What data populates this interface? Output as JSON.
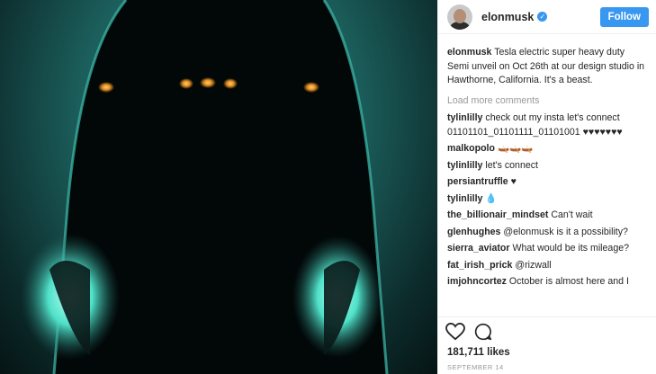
{
  "post": {
    "username": "elonmusk",
    "follow_label": "Follow",
    "verified_glyph": "✓",
    "caption": {
      "user": "elonmusk",
      "text": "Tesla electric super heavy duty Semi unveil on Oct 26th at our design studio in Hawthorne, California. It's a beast."
    },
    "load_more_label": "Load more comments",
    "comments": [
      {
        "user": "tylinlilly",
        "text": "check out my insta let's connect 01101101_01101111_01101001 ♥♥♥♥♥♥♥"
      },
      {
        "user": "malkopolo",
        "text": "🛶🛶🛶"
      },
      {
        "user": "tylinlilly",
        "text": "let's connect"
      },
      {
        "user": "persiantruffle",
        "text": "♥"
      },
      {
        "user": "tylinlilly",
        "text": "💧"
      },
      {
        "user": "the_billionair_mindset",
        "text": "Can't wait"
      },
      {
        "user": "glenhughes",
        "text": "@elonmusk is it a possibility?"
      },
      {
        "user": "sierra_aviator",
        "text": "What would be its mileage?"
      },
      {
        "user": "fat_irish_prick",
        "text": "@rizwall"
      },
      {
        "user": "imjohncortez",
        "text": "October is almost here and I"
      }
    ],
    "likes": "181,711 likes",
    "date": "SEPTEMBER 14",
    "icons": {
      "like": "heart-icon",
      "comment": "comment-bubble-icon"
    },
    "colors": {
      "accent": "#3897f0",
      "text": "#262626",
      "muted": "#999999"
    }
  }
}
